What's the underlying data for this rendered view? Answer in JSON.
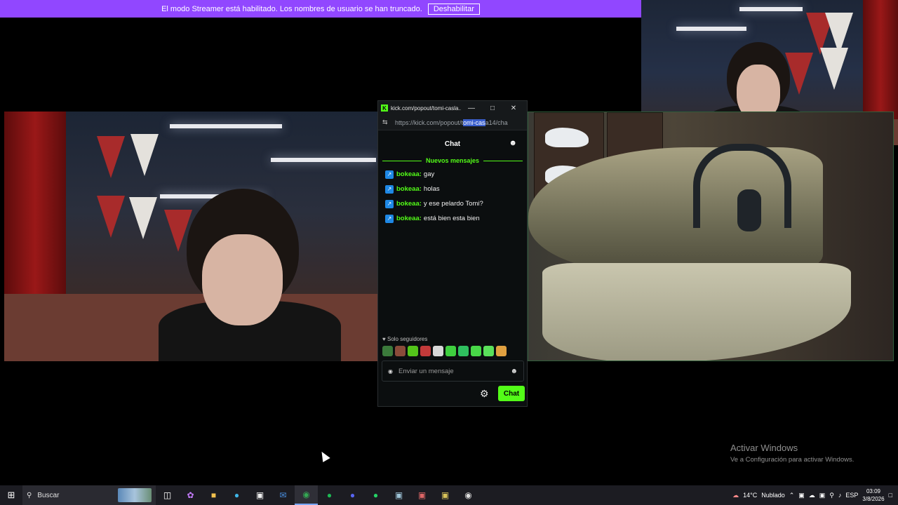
{
  "banner": {
    "message": "El modo Streamer está habilitado. Los nombres de usuario se han truncado.",
    "disable_label": "Deshabilitar"
  },
  "popout": {
    "window_title": "kick.com/popout/tomi-casla...",
    "url_prefix": "https://kick.com/popout/t",
    "url_selected": "omi-cas",
    "url_suffix": "a14/cha",
    "header": "Chat",
    "new_messages_label": "Nuevos mensajes",
    "messages": [
      {
        "user": "bokeaa:",
        "text": "gay"
      },
      {
        "user": "bokeaa:",
        "text": "holas"
      },
      {
        "user": "bokeaa:",
        "text": "y ese pelardo Tomi?"
      },
      {
        "user": "bokeaa:",
        "text": "está bien esta bien"
      }
    ],
    "followers_label": "Solo seguidores",
    "input_placeholder": "Enviar un mensaje",
    "send_label": "Chat"
  },
  "watermark": {
    "title": "Activar Windows",
    "subtitle": "Ve a Configuración para activar Windows."
  },
  "taskbar": {
    "search_label": "Buscar",
    "weather_temp": "14°C",
    "weather_desc": "Nublado",
    "language": "ESP",
    "time": "03:09",
    "date": "3/8/2026"
  },
  "colors": {
    "banner": "#9147ff",
    "kick_green": "#53fc18",
    "taskbar": "#1c1c22"
  }
}
